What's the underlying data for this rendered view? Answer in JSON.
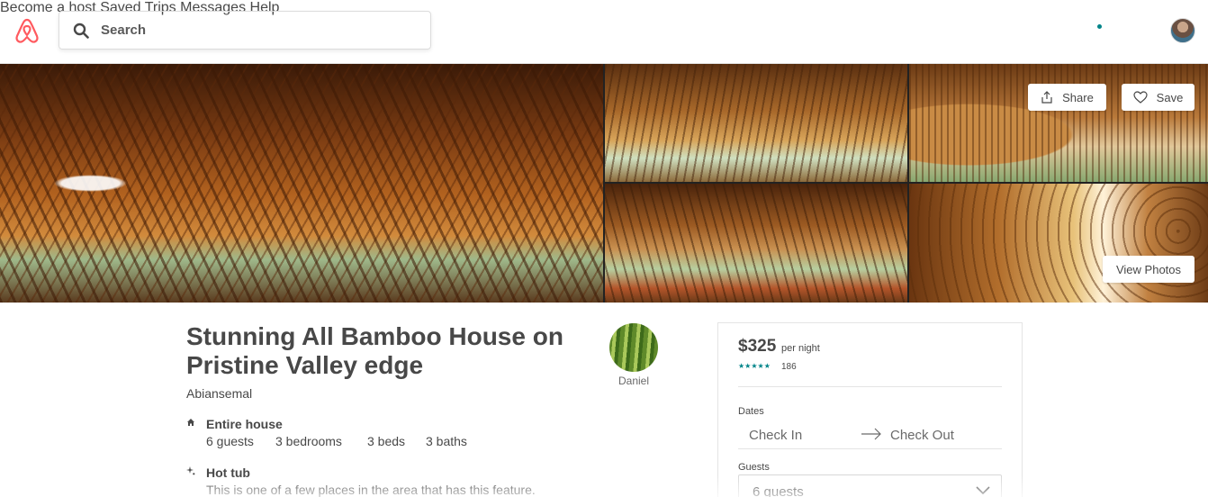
{
  "header": {
    "search_placeholder": "Search",
    "nav": {
      "become_host": "Become a host",
      "saved": "Saved",
      "trips": "Trips",
      "messages": "Messages",
      "help": "Help"
    },
    "brand_color": "#FF5A5F",
    "notification_color": "#008489"
  },
  "photos": {
    "share_label": "Share",
    "save_label": "Save",
    "view_photos_label": "View Photos"
  },
  "listing": {
    "title": "Stunning All Bamboo House on Pristine Valley edge",
    "location": "Abiansemal",
    "host_name": "Daniel",
    "features": [
      {
        "icon": "home-icon",
        "title": "Entire house",
        "details": [
          "6 guests",
          "3 bedrooms",
          "3 beds",
          "3 baths"
        ]
      },
      {
        "icon": "sparkle-icon",
        "title": "Hot tub",
        "description": "This is one of a few places in the area that has this feature."
      }
    ]
  },
  "booking": {
    "price": "$325",
    "per_night": "per night",
    "stars": "★★★★★",
    "review_count": "186",
    "dates_label": "Dates",
    "check_in": "Check In",
    "check_out": "Check Out",
    "guests_label": "Guests",
    "guests_value": "6 guests",
    "accent_color": "#008489"
  }
}
